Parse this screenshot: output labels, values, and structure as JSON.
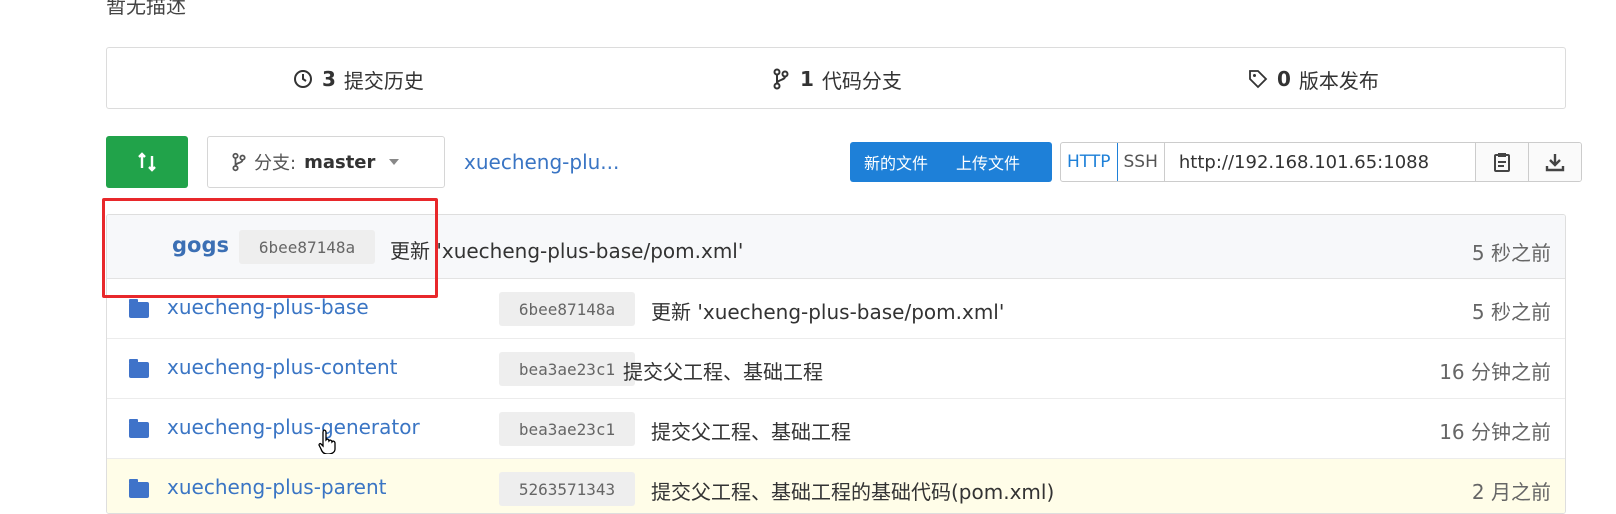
{
  "description": "暂无描述",
  "stats": {
    "commits_count": "3",
    "commits_label": "提交历史",
    "branches_count": "1",
    "branches_label": "代码分支",
    "releases_count": "0",
    "releases_label": "版本发布"
  },
  "toolbar": {
    "branch_prefix": "分支:",
    "branch_name": "master",
    "repo_link": "xuecheng-plu...",
    "new_file": "新的文件",
    "upload_file": "上传文件",
    "http": "HTTP",
    "ssh": "SSH",
    "clone_url": "http://192.168.101.65:1088"
  },
  "latest_commit": {
    "author": "gogs",
    "sha": "6bee87148a",
    "message": "更新 'xuecheng-plus-base/pom.xml'",
    "time": "5 秒之前"
  },
  "files": [
    {
      "name": "xuecheng-plus-base",
      "sha": "6bee87148a",
      "message": "更新 'xuecheng-plus-base/pom.xml'",
      "time": "5 秒之前"
    },
    {
      "name": "xuecheng-plus-content",
      "sha": "bea3ae23c1",
      "message": "提交父工程、基础工程",
      "time": "16 分钟之前"
    },
    {
      "name": "xuecheng-plus-generator",
      "sha": "bea3ae23c1",
      "message": "提交父工程、基础工程",
      "time": "16 分钟之前"
    },
    {
      "name": "xuecheng-plus-parent",
      "sha": "5263571343",
      "message": "提交父工程、基础工程的基础代码(pom.xml)",
      "time": "2 月之前"
    }
  ],
  "colors": {
    "accent": "#1e80d8",
    "green": "#21a34a",
    "highlight": "#e8282b"
  }
}
